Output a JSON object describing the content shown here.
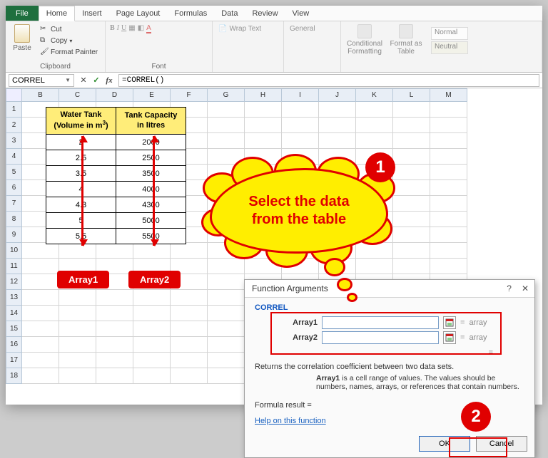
{
  "tabs": {
    "file": "File",
    "home": "Home",
    "insert": "Insert",
    "page_layout": "Page Layout",
    "formulas": "Formulas",
    "data": "Data",
    "review": "Review",
    "view": "View"
  },
  "ribbon": {
    "clipboard": {
      "paste": "Paste",
      "cut": "Cut",
      "copy": "Copy",
      "format_painter": "Format Painter",
      "title": "Clipboard"
    },
    "font": {
      "title": "Font"
    },
    "alignment": {
      "wrap": "Wrap Text"
    },
    "number": {
      "general": "General"
    },
    "styles": {
      "conditional": "Conditional\nFormatting",
      "format_table": "Format as\nTable",
      "normal": "Normal",
      "neutral": "Neutral"
    }
  },
  "formula_bar": {
    "namebox": "CORREL",
    "x": "✕",
    "check": "✓",
    "fx": "fx",
    "formula": "=CORREL()"
  },
  "columns": [
    "B",
    "C",
    "D",
    "E",
    "F",
    "G",
    "H",
    "I",
    "J",
    "K",
    "L",
    "M"
  ],
  "rows": [
    "1",
    "2",
    "3",
    "4",
    "5",
    "6",
    "7",
    "8",
    "9",
    "10",
    "11",
    "12",
    "13",
    "14",
    "15",
    "16",
    "17",
    "18"
  ],
  "table": {
    "h1a": "Water Tank",
    "h1b": "(Volume in m",
    "h1c": ")",
    "sup": "3",
    "h2a": "Tank Capacity",
    "h2b": "in litres",
    "rows": [
      {
        "vol": "2",
        "cap": "2000"
      },
      {
        "vol": "2.5",
        "cap": "2500"
      },
      {
        "vol": "3.5",
        "cap": "3500"
      },
      {
        "vol": "4",
        "cap": "4000"
      },
      {
        "vol": "4.3",
        "cap": "4300"
      },
      {
        "vol": "5",
        "cap": "5000"
      },
      {
        "vol": "5.5",
        "cap": "5500"
      }
    ]
  },
  "labels": {
    "array1": "Array1",
    "array2": "Array2"
  },
  "callout": {
    "line1": "Select the data",
    "line2": "from the table"
  },
  "badges": {
    "one": "1",
    "two": "2"
  },
  "dialog": {
    "title": "Function Arguments",
    "help_q": "?",
    "close": "✕",
    "func": "CORREL",
    "arg1": "Array1",
    "arg2": "Array2",
    "eq": "=",
    "array_word": "array",
    "desc": "Returns the correlation coefficient between two data sets.",
    "arg_help_name": "Array1",
    "arg_help_text": "is a cell range of values. The values should be numbers, names, arrays, or references that contain numbers.",
    "result_label": "Formula result =",
    "help_link": "Help on this function",
    "ok": "OK",
    "cancel": "Cancel"
  }
}
